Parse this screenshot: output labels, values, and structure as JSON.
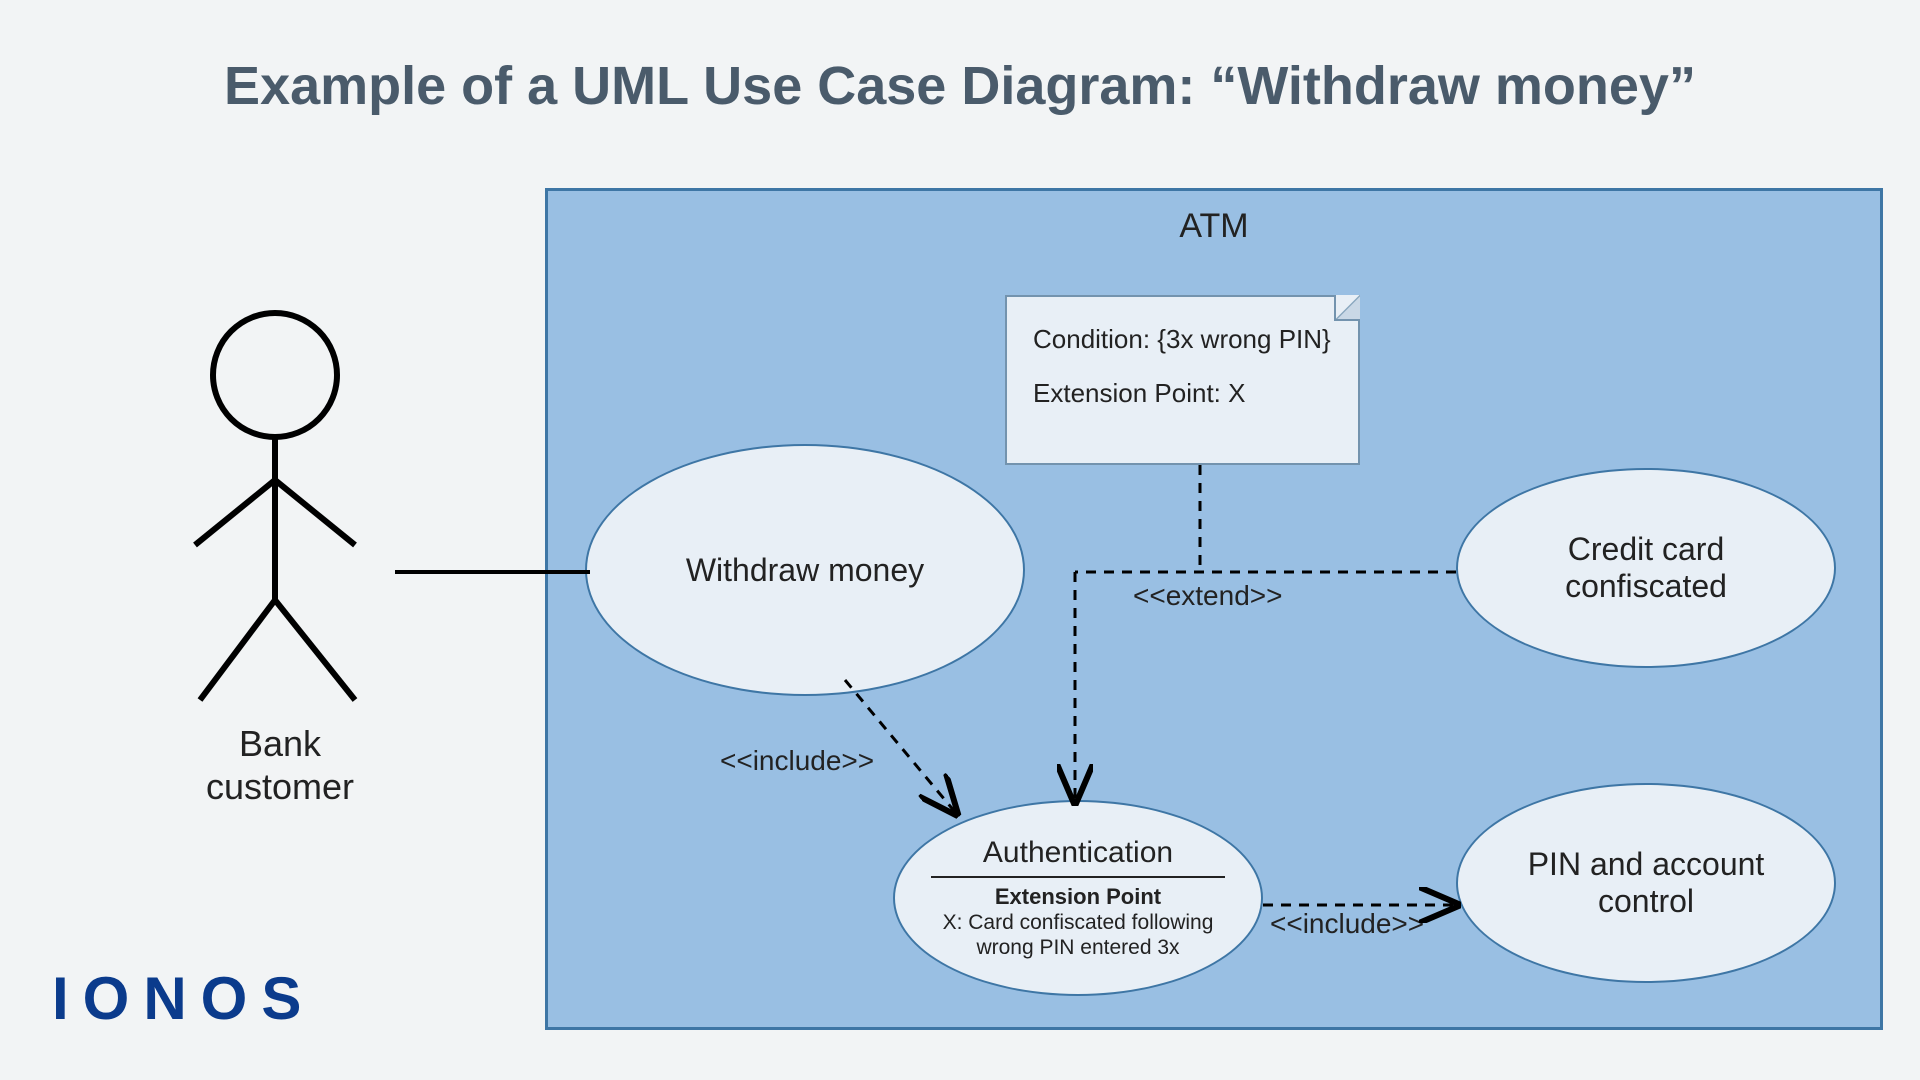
{
  "title": "Example of a UML Use Case Diagram: “Withdraw money”",
  "system_label": "ATM",
  "actor_label": "Bank\ncustomer",
  "note": {
    "line1": "Condition: {3x wrong PIN}",
    "line2": "Extension Point: X"
  },
  "usecases": {
    "withdraw": "Withdraw money",
    "credit": "Credit card confiscated",
    "pin": "PIN and account control",
    "auth": {
      "title": "Authentication",
      "ext_header": "Extension Point",
      "ext_body": "X: Card confiscated following wrong PIN entered 3x"
    }
  },
  "relationships": {
    "include": "<<include>>",
    "extend": "<<extend>>"
  },
  "brand": "IONOS"
}
